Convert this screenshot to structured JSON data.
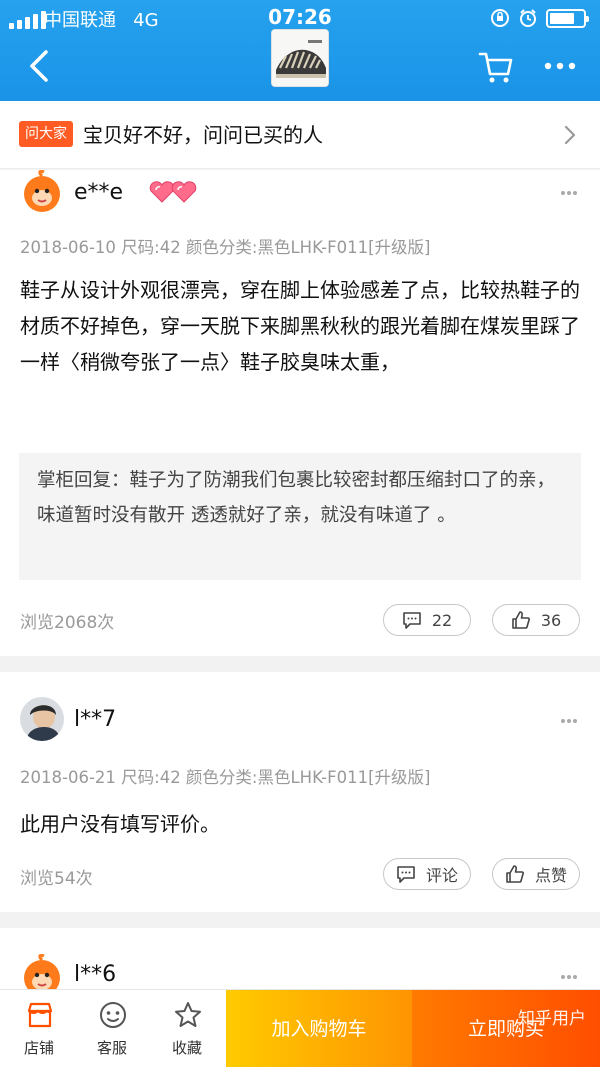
{
  "status_bar": {
    "carrier": "中国联通",
    "network": "4G",
    "time": "07:26"
  },
  "ask_banner": {
    "tag": "问大家",
    "text": "宝贝好不好，问问已买的人"
  },
  "reviews": [
    {
      "user": "e**e",
      "avatar_icon": "taobao-mascot-avatar",
      "badge_icon": "double-heart-icon",
      "meta": "2018-06-10  尺码:42 颜色分类:黑色LHK-F011[升级版]",
      "content": "鞋子从设计外观很漂亮，穿在脚上体验感差了点，比较热鞋子的材质不好掉色，穿一天脱下来脚黑秋秋的跟光着脚在煤炭里踩了一样〈稍微夸张了一点〉鞋子胶臭味太重，",
      "seller_reply": "掌柜回复：鞋子为了防潮我们包裹比较密封都压缩封口了的亲，味道暂时没有散开 透透就好了亲，就没有味道了 。",
      "views": "浏览2068次",
      "comment_label": "22",
      "like_label": "36"
    },
    {
      "user": "l**7",
      "avatar_icon": "user-photo-avatar",
      "meta": "2018-06-21  尺码:42 颜色分类:黑色LHK-F011[升级版]",
      "content": "此用户没有填写评价。",
      "views": "浏览54次",
      "comment_label": "评论",
      "like_label": "点赞"
    },
    {
      "user": "l**6",
      "avatar_icon": "taobao-mascot-avatar"
    }
  ],
  "bottom_bar": {
    "shop_label": "店铺",
    "service_label": "客服",
    "favorite_label": "收藏",
    "add_to_cart_label": "加入购物车",
    "buy_now_label": "立即购买",
    "watermark": "知乎用户"
  },
  "colors": {
    "header_blue": "#1a93e8",
    "ask_tag_orange": "#ff5b23",
    "add_cart_gradient": [
      "#ffcb00",
      "#ff9402"
    ],
    "buy_now_gradient": [
      "#ff7a00",
      "#ff4e00"
    ]
  }
}
